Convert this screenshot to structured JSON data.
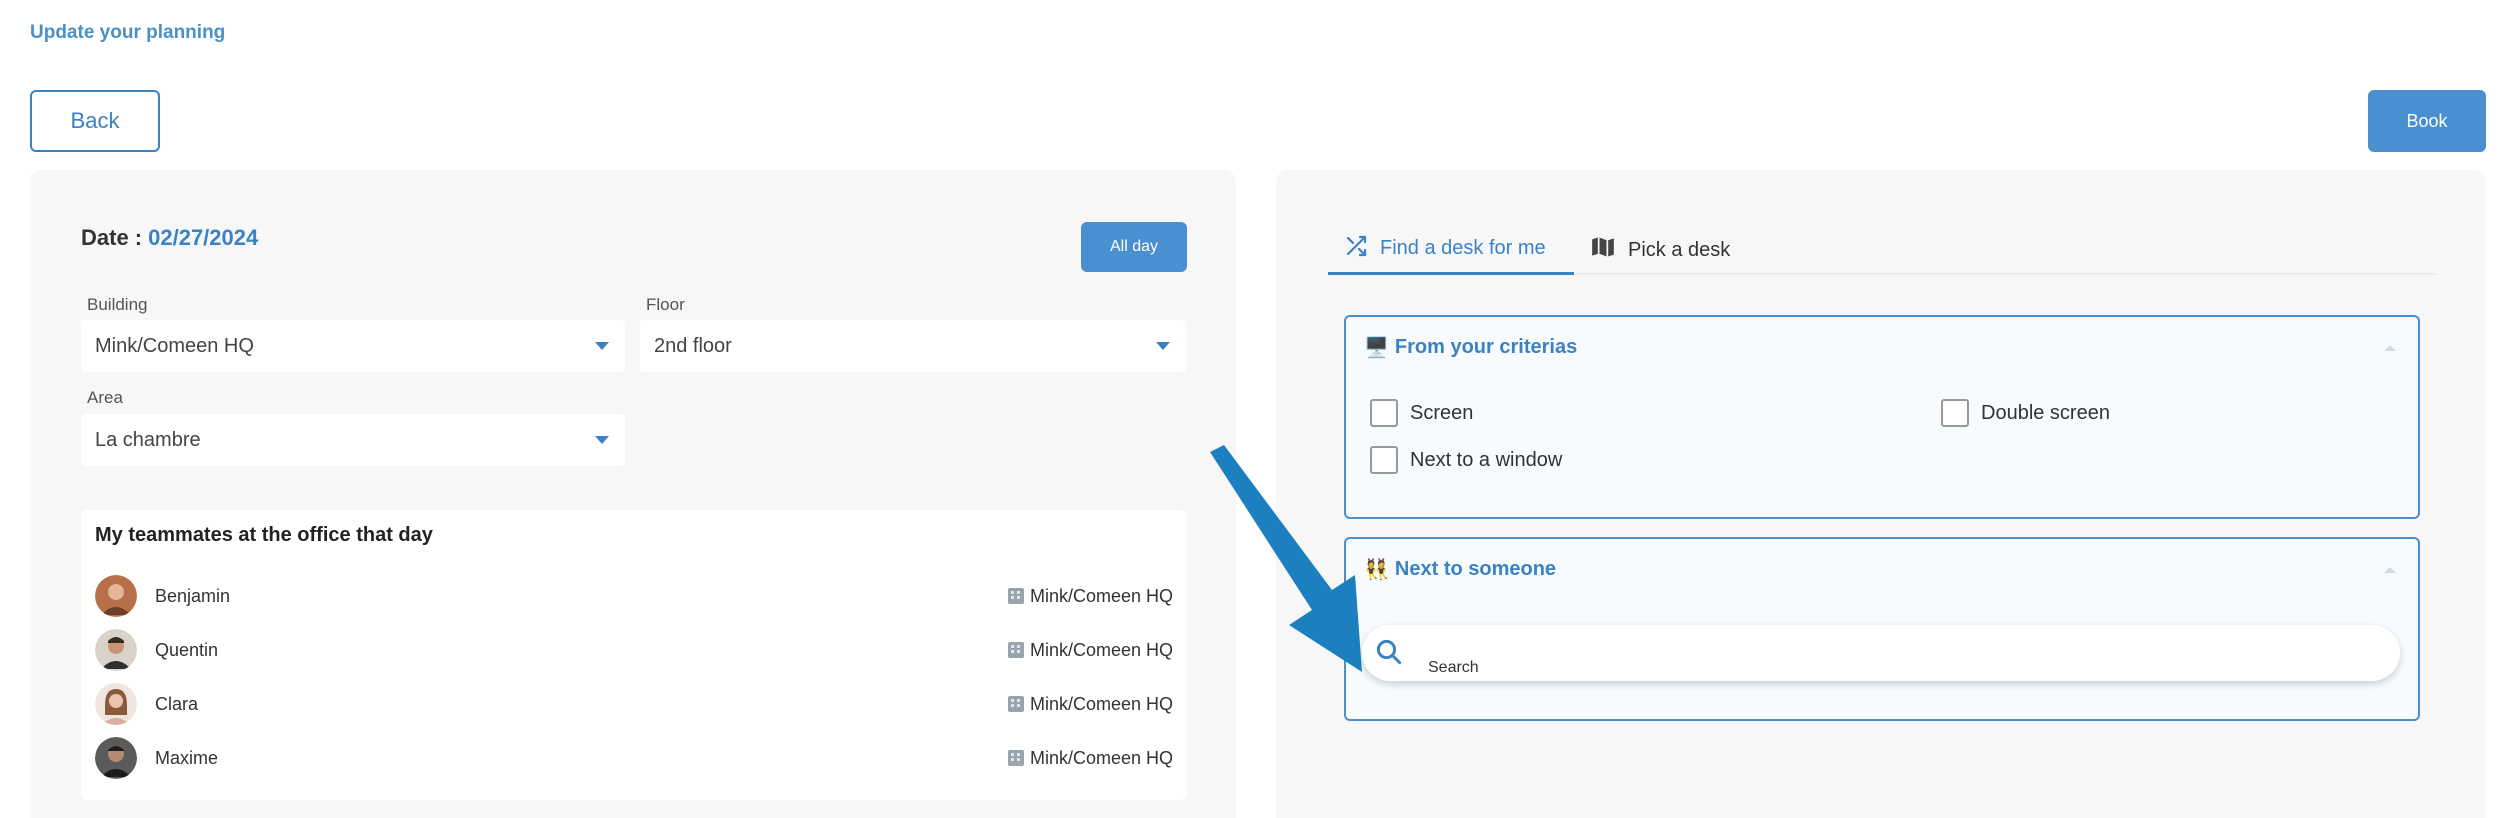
{
  "page": {
    "title": "Update your planning",
    "back_label": "Back",
    "book_label": "Book"
  },
  "left_panel": {
    "date_label": "Date :",
    "date_value": "02/27/2024",
    "all_day_label": "All day",
    "building": {
      "label": "Building",
      "value": "Mink/Comeen HQ"
    },
    "floor": {
      "label": "Floor",
      "value": "2nd floor"
    },
    "area": {
      "label": "Area",
      "value": "La chambre"
    },
    "teammates": {
      "title": "My teammates at the office that day",
      "items": [
        {
          "name": "Benjamin",
          "location": "Mink/Comeen HQ",
          "avatar_color": "#b8704a"
        },
        {
          "name": "Quentin",
          "location": "Mink/Comeen HQ",
          "avatar_color": "#5b4a3e"
        },
        {
          "name": "Clara",
          "location": "Mink/Comeen HQ",
          "avatar_color": "#c99a82"
        },
        {
          "name": "Maxime",
          "location": "Mink/Comeen HQ",
          "avatar_color": "#3a3a3a"
        }
      ]
    }
  },
  "right_panel": {
    "tabs": [
      {
        "label": "Find a desk for me",
        "icon": "shuffle-icon",
        "active": true
      },
      {
        "label": "Pick a desk",
        "icon": "map-icon",
        "active": false
      }
    ],
    "criterias": {
      "emoji": "🖥️",
      "title": "From your criterias",
      "options": [
        {
          "label": "Screen",
          "checked": false
        },
        {
          "label": "Double screen",
          "checked": false
        },
        {
          "label": "Next to a window",
          "checked": false
        }
      ]
    },
    "next_to_someone": {
      "emoji": "👯",
      "title": "Next to someone",
      "search_placeholder": "Search"
    }
  },
  "colors": {
    "accent": "#3b82c4",
    "button_fill": "#4a90d0",
    "panel_bg": "#f7f7f7",
    "annotation_arrow": "#1c7fc0"
  }
}
